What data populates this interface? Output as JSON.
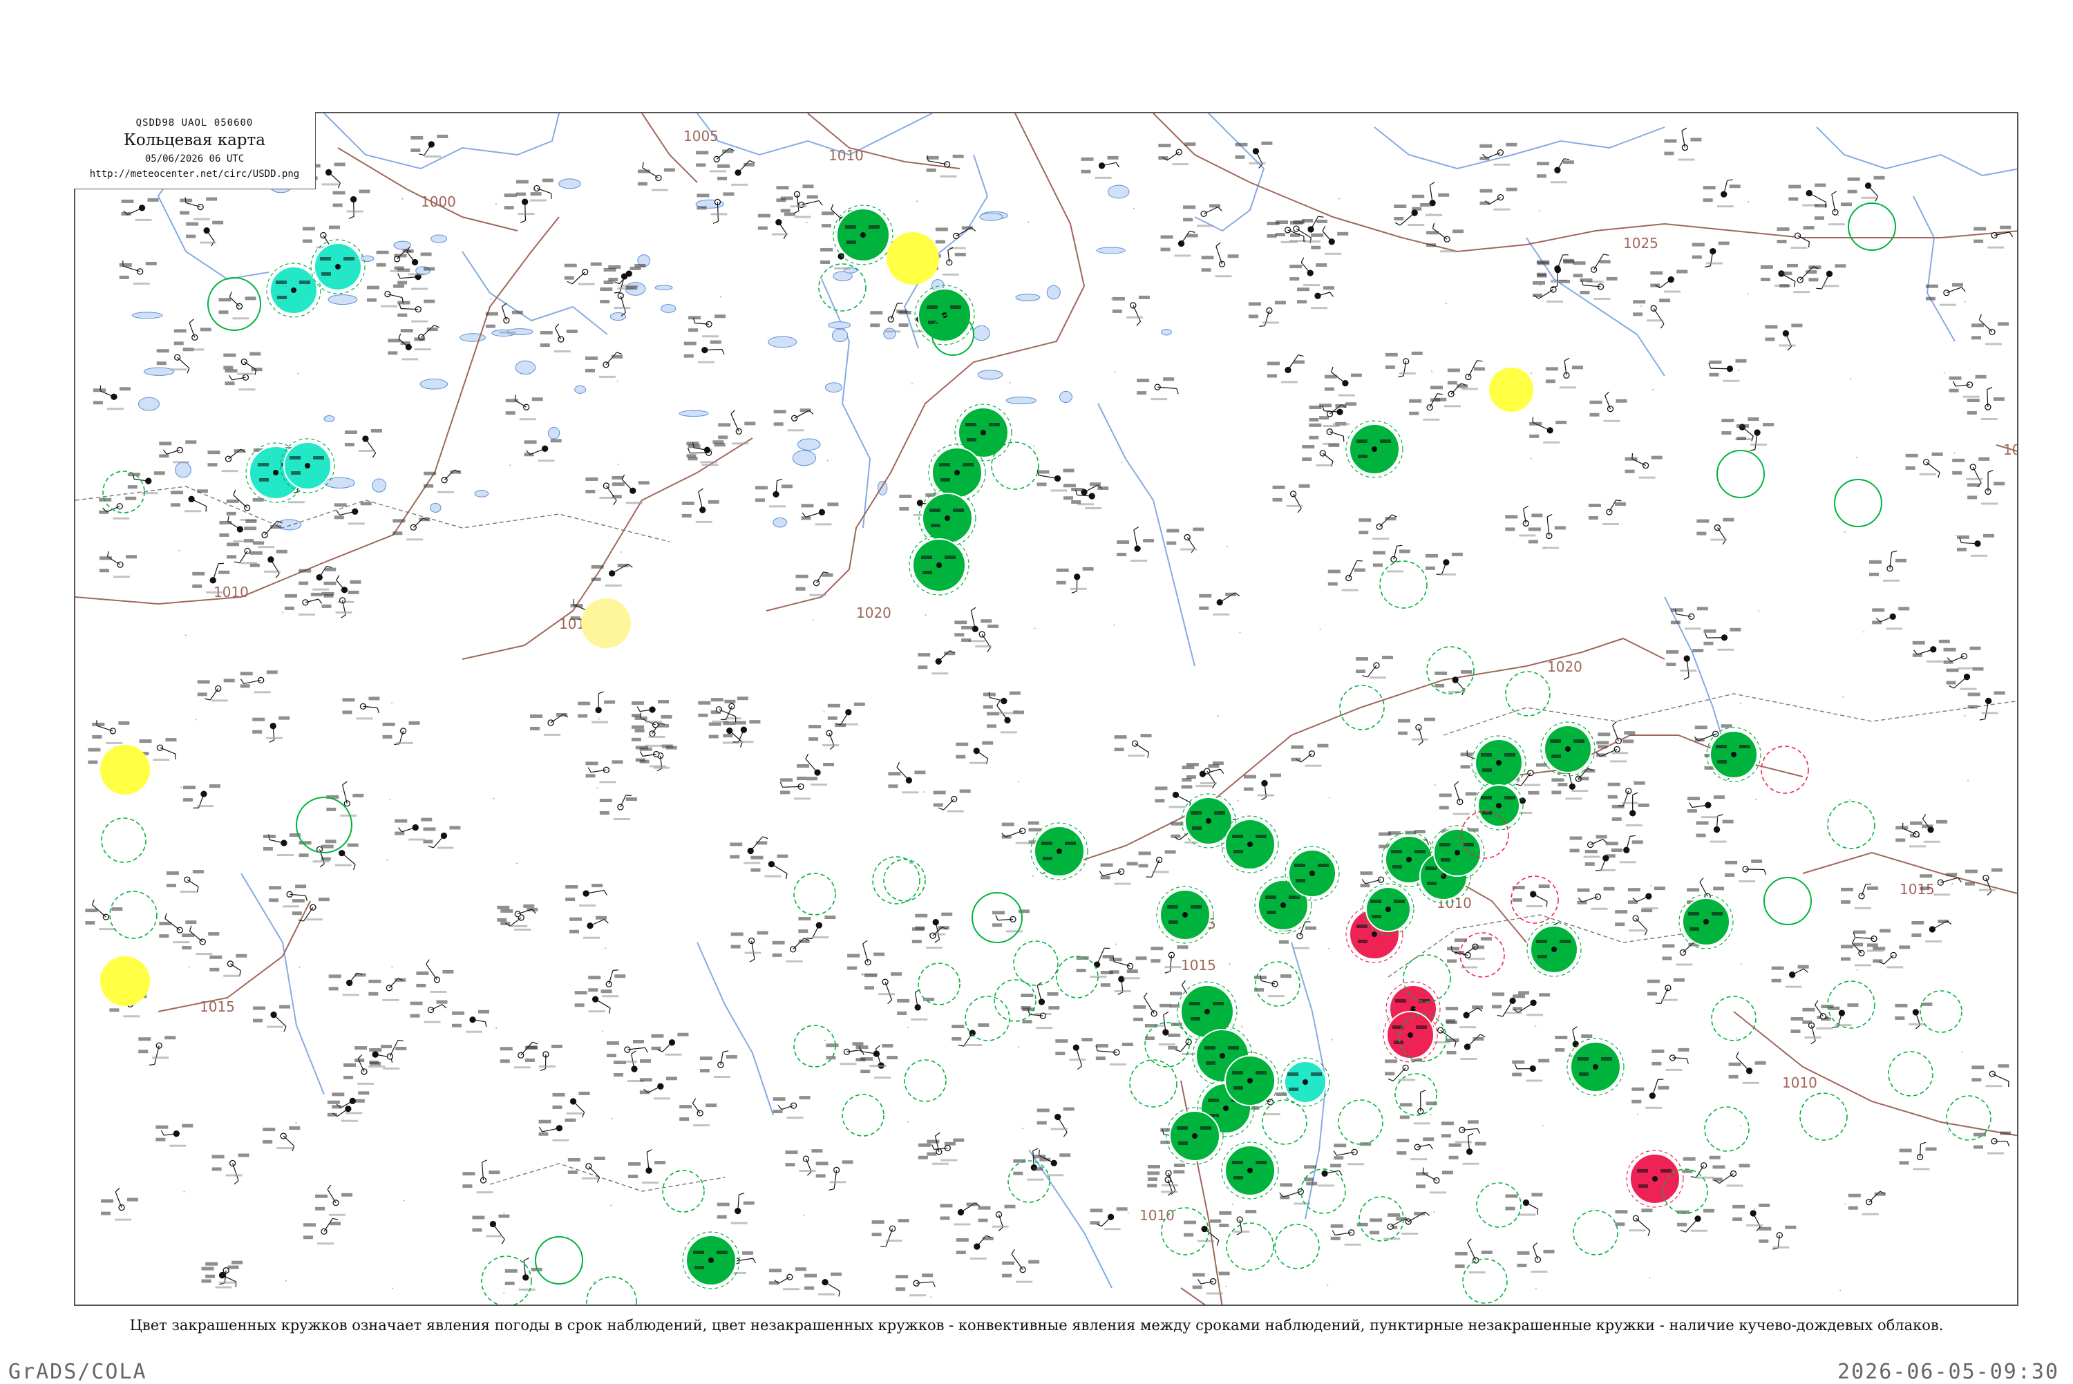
{
  "title": {
    "code": "QSDD98  UAOL  050600",
    "name": "Кольцевая карта",
    "datetime": "05/06/2026 06 UTC",
    "url": "http://meteocenter.net/circ/USDD.png"
  },
  "isobars": [
    {
      "label": "1005"
    },
    {
      "label": "1010"
    },
    {
      "label": "1000"
    },
    {
      "label": "1010"
    },
    {
      "label": "1015"
    },
    {
      "label": "1020"
    },
    {
      "label": "1025"
    },
    {
      "label": "1020"
    },
    {
      "label": "1015"
    },
    {
      "label": "1015"
    },
    {
      "label": "1010"
    },
    {
      "label": "1015"
    },
    {
      "label": "1015"
    },
    {
      "label": "1010"
    },
    {
      "label": "1010"
    },
    {
      "label": "1015"
    },
    {
      "label": "10"
    }
  ],
  "legend": {
    "caption": "Цвет закрашенных кружков означает явления погоды в срок наблюдений, цвет незакрашенных кружков - конвективные явления между сроками наблюдений, пунктирные незакрашенные кружки - наличие кучево-дождевых облаков."
  },
  "colors": {
    "rain": "#00b33c",
    "thunder": "#ee2255",
    "snow": "#22e8c8",
    "fog": "#ffff44",
    "fog_pale": "#fff59a",
    "isobar": "#a0665a",
    "water": "#5b8fd9",
    "land_border": "#777777"
  },
  "footer": {
    "left": "GrADS/COLA",
    "right": "2026-06-05-09:30"
  }
}
